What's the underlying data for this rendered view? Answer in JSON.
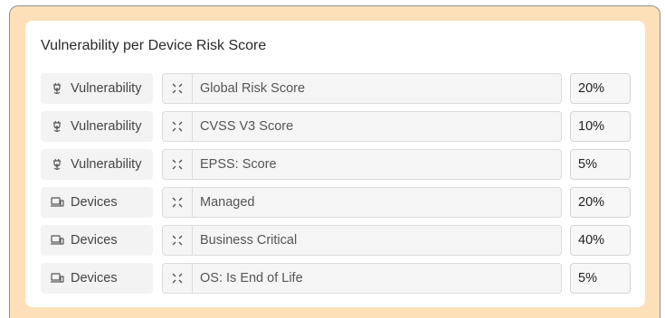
{
  "panel": {
    "title": "Vulnerability per Device Risk Score",
    "rows": [
      {
        "category": "Vulnerability",
        "category_icon": "bug-icon",
        "factor": "Global Risk Score",
        "weight": "20%"
      },
      {
        "category": "Vulnerability",
        "category_icon": "bug-icon",
        "factor": "CVSS V3 Score",
        "weight": "10%"
      },
      {
        "category": "Vulnerability",
        "category_icon": "bug-icon",
        "factor": "EPSS: Score",
        "weight": "5%"
      },
      {
        "category": "Devices",
        "category_icon": "devices-icon",
        "factor": "Managed",
        "weight": "20%"
      },
      {
        "category": "Devices",
        "category_icon": "devices-icon",
        "factor": "Business Critical",
        "weight": "40%"
      },
      {
        "category": "Devices",
        "category_icon": "devices-icon",
        "factor": "OS: Is End of Life",
        "weight": "5%"
      }
    ]
  },
  "colors": {
    "frame_bg": "#fde0b8",
    "card_bg": "#ffffff",
    "chip_bg": "#f3f3f3",
    "field_bg": "#f5f5f5"
  }
}
